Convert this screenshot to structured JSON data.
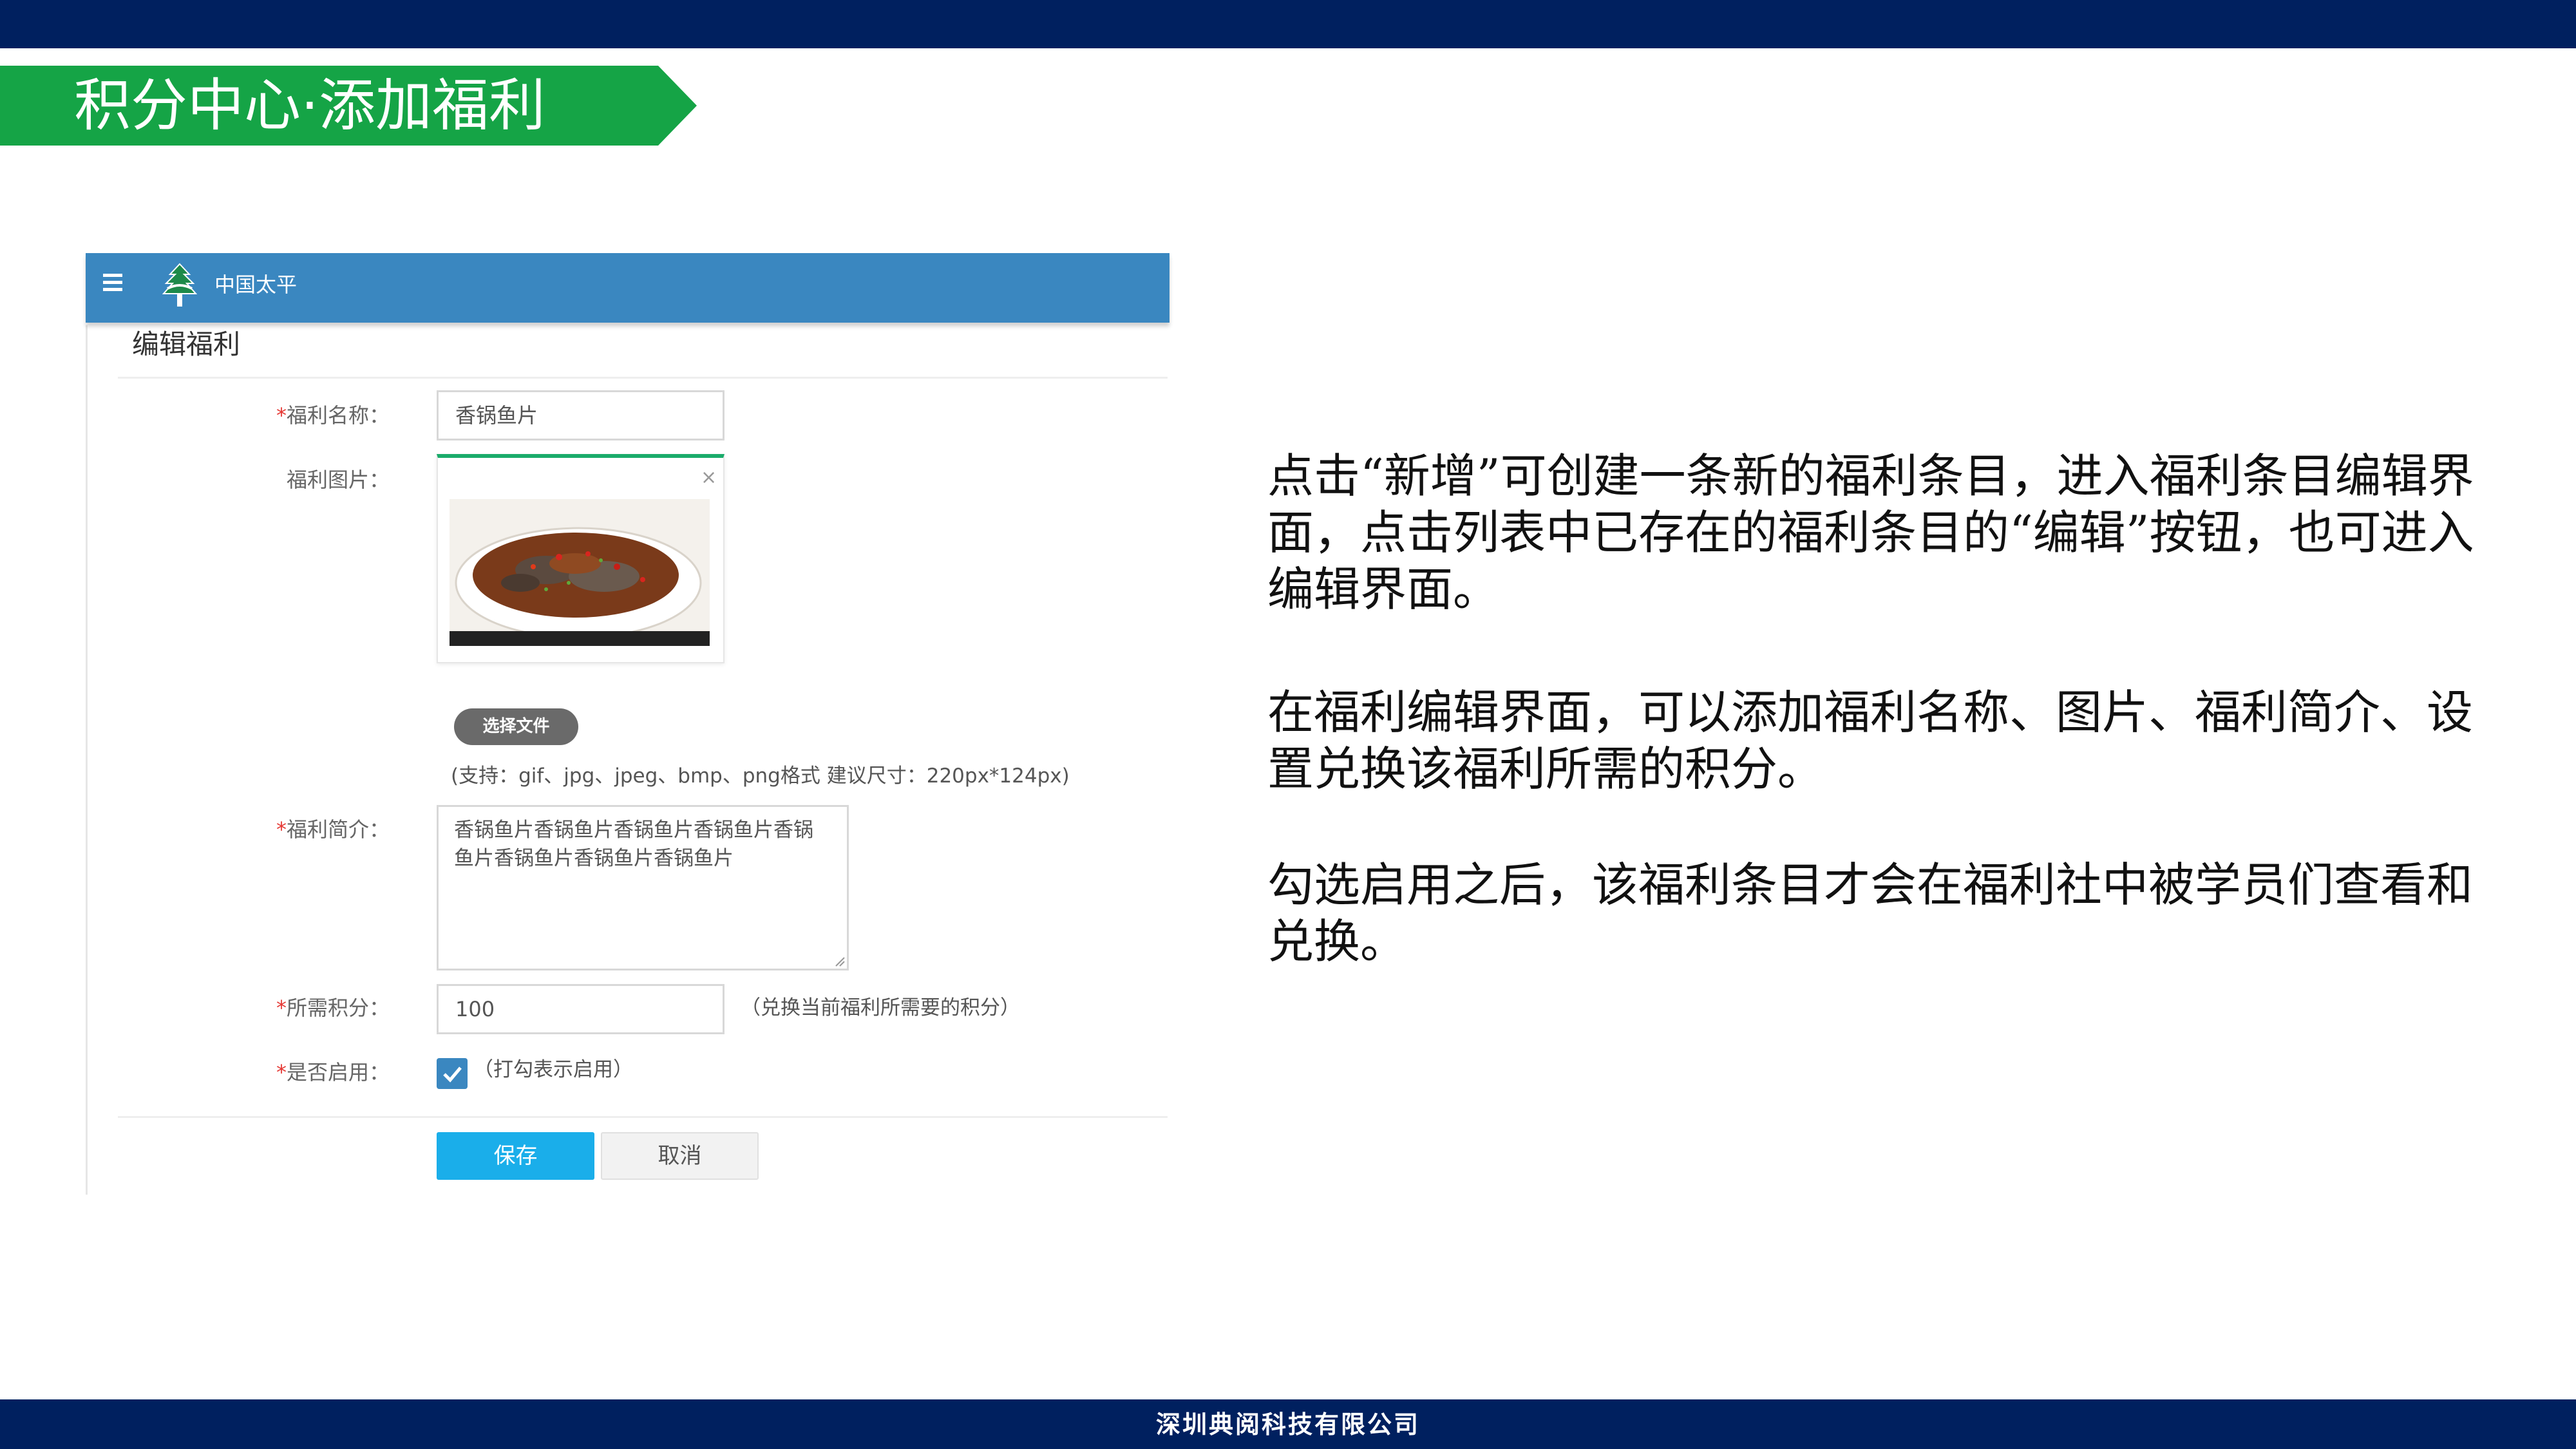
{
  "slide": {
    "title": "积分中心·添加福利",
    "footer": "深圳典阅科技有限公司"
  },
  "app": {
    "brand": "中国太平",
    "page_heading": "编辑福利",
    "form": {
      "name_label": "福利名称：",
      "name_value": "香锅鱼片",
      "image_label": "福利图片：",
      "close_symbol": "×",
      "choose_file_label": "选择文件",
      "format_hint": "(支持：gif、jpg、jpeg、bmp、png格式   建议尺寸：220px*124px)",
      "intro_label": "福利简介：",
      "intro_value": "香锅鱼片香锅鱼片香锅鱼片香锅鱼片香锅鱼片香锅鱼片香锅鱼片香锅鱼片",
      "points_label": "所需积分：",
      "points_value": "100",
      "points_hint": "（兑换当前福利所需要的积分）",
      "enable_label": "是否启用：",
      "enable_checked": true,
      "enable_hint": "（打勾表示启用）",
      "required_mark": "*"
    },
    "buttons": {
      "save": "保存",
      "cancel": "取消"
    },
    "icons": [
      "menu-icon",
      "pine-tree-logo-icon",
      "close-icon",
      "check-icon"
    ]
  },
  "description": {
    "p1": "点击“新增”可创建一条新的福利条目，进入福利条目编辑界面，点击列表中已存在的福利条目的“编辑”按钮，也可进入编辑界面。",
    "p2": "在福利编辑界面，可以添加福利名称、图片、福利简介、设置兑换该福利所需的积分。",
    "p3": "勾选启用之后，该福利条目才会在福利社中被学员们查看和兑换。"
  },
  "colors": {
    "navy": "#00205f",
    "banner_green": "#15a446",
    "header_blue": "#3a87c0",
    "save_blue": "#1aaeea"
  }
}
